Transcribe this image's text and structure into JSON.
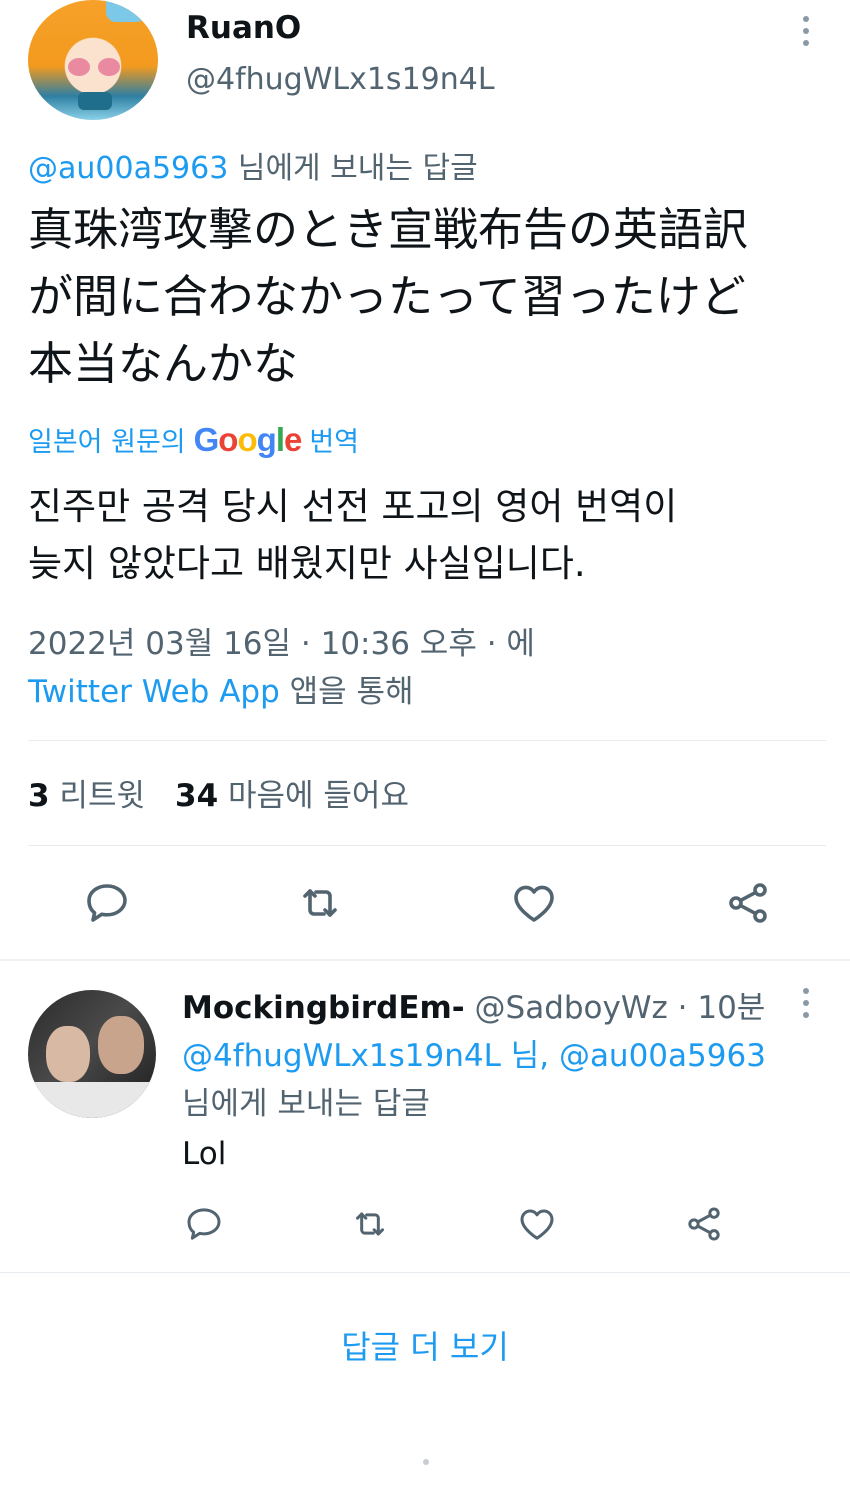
{
  "tweet": {
    "author": {
      "name": "RuanO",
      "handle": "@4fhugWLx1s19n4L"
    },
    "reply_to": {
      "handle": "@au00a5963",
      "suffix": " 님에게 보내는 답글"
    },
    "text_lines": [
      "真珠湾攻撃のとき宣戦布告の英語訳",
      "が間に合わなかったって習ったけど",
      "本当なんかな"
    ],
    "translation": {
      "label": "일본어 원문의",
      "google": [
        "G",
        "o",
        "o",
        "g",
        "l",
        "e"
      ],
      "action": "번역",
      "lines": [
        "진주만 공격 당시 선전 포고의 영어 번역이",
        "늦지 않았다고 배웠지만 사실입니다."
      ]
    },
    "meta": {
      "line1": "2022년 03월 16일 · 10:36 오후 · 에",
      "source": "Twitter Web App",
      "via": " 앱을 통해"
    },
    "stats": {
      "retweets_count": "3",
      "retweets_label": " 리트윗",
      "likes_count": "34",
      "likes_label": " 마음에 들어요"
    }
  },
  "reply": {
    "author": {
      "name": "MockingbirdEm-",
      "handle": " @SadboyWz",
      "time": " · 10분"
    },
    "mentions": {
      "first": "@4fhugWLx1s19n4L",
      "joiner": " 님, ",
      "second": "@au00a5963",
      "suffix": "님에게 보내는 답글"
    },
    "text": "Lol"
  },
  "footer": {
    "show_more": "답글 더 보기"
  },
  "colors": {
    "accent": "#1d9bf0",
    "text": "#0f1419",
    "muted": "#536471",
    "divider": "#e6ecf0"
  },
  "icons": [
    "more-vertical-icon",
    "reply-icon",
    "retweet-icon",
    "like-icon",
    "share-icon"
  ]
}
